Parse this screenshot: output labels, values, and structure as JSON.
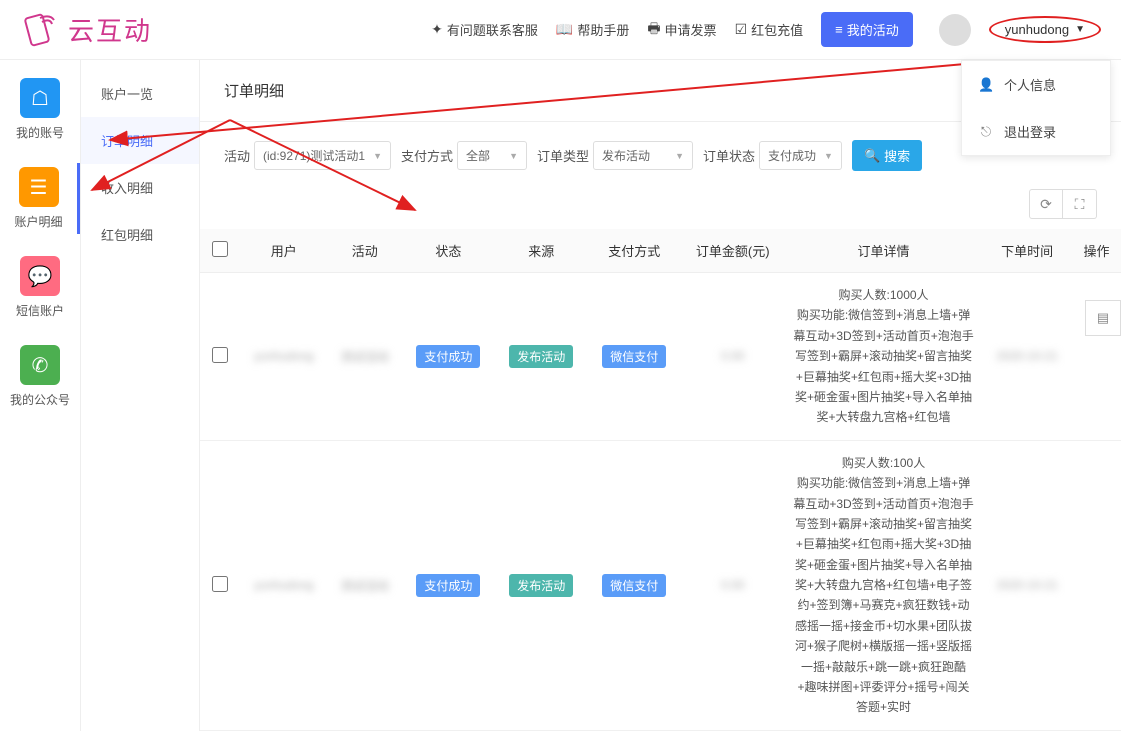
{
  "header": {
    "logo_text": "云互动",
    "links": {
      "contact": "有问题联系客服",
      "help": "帮助手册",
      "invoice": "申请发票",
      "recharge": "红包充值"
    },
    "my_activities": "我的活动",
    "username": "yunhudong"
  },
  "dropdown": {
    "profile": "个人信息",
    "logout": "退出登录"
  },
  "sidebar_icons": {
    "account": "我的账号",
    "account_detail": "账户明细",
    "sms": "短信账户",
    "wechat": "我的公众号"
  },
  "sidebar_sub": {
    "overview": "账户一览",
    "order_detail": "订单明细",
    "income_detail": "收入明细",
    "redpacket_detail": "红包明细"
  },
  "page_title": "订单明细",
  "filters": {
    "activity_label": "活动",
    "activity_value": "(id:9271)测试活动1",
    "pay_method_label": "支付方式",
    "pay_method_value": "全部",
    "order_type_label": "订单类型",
    "order_type_value": "发布活动",
    "order_status_label": "订单状态",
    "order_status_value": "支付成功",
    "search_button": "搜索"
  },
  "table": {
    "headers": {
      "user": "用户",
      "activity": "活动",
      "status": "状态",
      "source": "来源",
      "pay_method": "支付方式",
      "amount": "订单金额(元)",
      "detail": "订单详情",
      "time": "下单时间",
      "action": "操作"
    },
    "rows": [
      {
        "user_blur": "yunhudong",
        "activity_blur": "测试活动",
        "status": "支付成功",
        "source": "发布活动",
        "pay_method": "微信支付",
        "amount_blur": "0.00",
        "detail": "购买人数:1000人\n购买功能:微信签到+消息上墙+弹幕互动+3D签到+活动首页+泡泡手写签到+霸屏+滚动抽奖+留言抽奖+巨幕抽奖+红包雨+摇大奖+3D抽奖+砸金蛋+图片抽奖+导入名单抽奖+大转盘九宫格+红包墙",
        "time_blur": "2020-10-21"
      },
      {
        "user_blur": "yunhudong",
        "activity_blur": "测试活动",
        "status": "支付成功",
        "source": "发布活动",
        "pay_method": "微信支付",
        "amount_blur": "0.00",
        "detail": "购买人数:100人\n购买功能:微信签到+消息上墙+弹幕互动+3D签到+活动首页+泡泡手写签到+霸屏+滚动抽奖+留言抽奖+巨幕抽奖+红包雨+摇大奖+3D抽奖+砸金蛋+图片抽奖+导入名单抽奖+大转盘九宫格+红包墙+电子签约+签到簿+马赛克+疯狂数钱+动感摇一摇+接金币+切水果+团队拔河+猴子爬树+横版摇一摇+竖版摇一摇+敲敲乐+跳一跳+疯狂跑酷+趣味拼图+评委评分+摇号+闯关答题+实时",
        "time_blur": "2020-10-21"
      }
    ]
  }
}
